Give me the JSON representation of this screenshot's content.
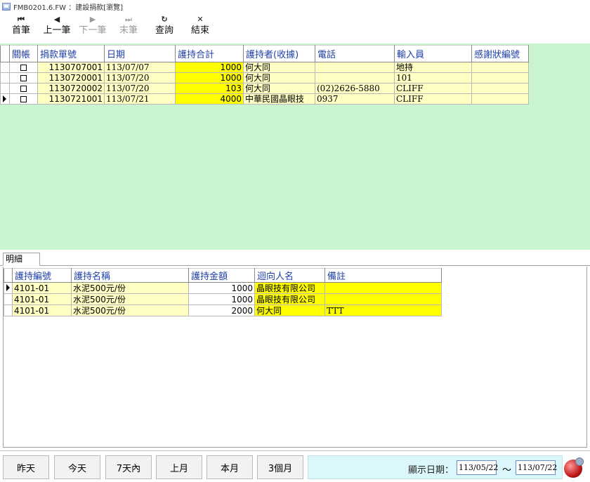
{
  "window": {
    "title": "FMB0201.6.FW ：建設捐款[瀏覽]"
  },
  "toolbar": {
    "buttons": [
      {
        "icon": "⏮",
        "label": "首筆",
        "enabled": true
      },
      {
        "icon": "◀",
        "label": "上一筆",
        "enabled": true
      },
      {
        "icon": "▶",
        "label": "下一筆",
        "enabled": false
      },
      {
        "icon": "⏭",
        "label": "末筆",
        "enabled": false
      },
      {
        "icon": "↻",
        "label": "查詢",
        "enabled": true
      },
      {
        "icon": "✕",
        "label": "結束",
        "enabled": true
      }
    ]
  },
  "master": {
    "columns": [
      "關帳",
      "捐款單號",
      "日期",
      "護持合計",
      "護持者(收據)",
      "電話",
      "輸入員",
      "感謝狀編號"
    ],
    "rows": [
      {
        "closed": false,
        "doc_no": "1130707001",
        "date": "113/07/07",
        "total": "1000",
        "donor": "何大同",
        "phone": "",
        "operator": "地持",
        "cert_no": "",
        "current": false
      },
      {
        "closed": false,
        "doc_no": "1130720001",
        "date": "113/07/20",
        "total": "1000",
        "donor": "何大同",
        "phone": "",
        "operator": "101",
        "cert_no": "",
        "current": false
      },
      {
        "closed": false,
        "doc_no": "1130720002",
        "date": "113/07/20",
        "total": "103",
        "donor": "何大同",
        "phone": "(02)2626-5880",
        "operator": "CLIFF",
        "cert_no": "",
        "current": false
      },
      {
        "closed": false,
        "doc_no": "1130721001",
        "date": "113/07/21",
        "total": "4000",
        "donor": "中華民國晶眼技",
        "phone": "0937",
        "operator": "CLIFF",
        "cert_no": "",
        "current": true
      }
    ]
  },
  "detail_tab": {
    "label": "明細"
  },
  "detail": {
    "columns": [
      "護持編號",
      "護持名稱",
      "護持金額",
      "迴向人名",
      "備註"
    ],
    "rows": [
      {
        "code": "4101-01",
        "name": "水泥500元/份",
        "amount": "1000",
        "dedicate": "晶眼技有限公司",
        "note": "",
        "current": true
      },
      {
        "code": "4101-01",
        "name": "水泥500元/份",
        "amount": "1000",
        "dedicate": "晶眼技有限公司",
        "note": "",
        "current": false
      },
      {
        "code": "4101-01",
        "name": "水泥500元/份",
        "amount": "2000",
        "dedicate": "何大同",
        "note": "TTT",
        "current": false
      }
    ]
  },
  "bottom": {
    "buttons": [
      "昨天",
      "今天",
      "7天內",
      "上月",
      "本月",
      "3個月"
    ],
    "range_label": "顯示日期：",
    "date_from": "113/05/22",
    "tilde": "～",
    "date_to": "113/07/22"
  },
  "colors": {
    "master_bg": "#c8f5cf",
    "header_text": "#1e3fa8",
    "highlight": "#ffff00",
    "light_yellow": "#ffffc4",
    "range_bg": "#dcf7fb"
  }
}
